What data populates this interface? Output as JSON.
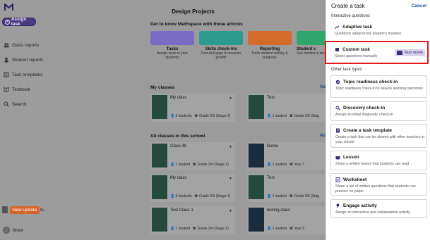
{
  "sidebar": {
    "assign_label": "Assign task",
    "items": [
      {
        "label": "Class reports",
        "icon": "people-icon"
      },
      {
        "label": "Student reports",
        "icon": "person-icon"
      },
      {
        "label": "Task templates",
        "icon": "templates-icon"
      },
      {
        "label": "Textbook",
        "icon": "book-icon"
      },
      {
        "label": "Search",
        "icon": "search-icon"
      }
    ],
    "new_update_label": "New update",
    "hidden_label_fragment": "ts",
    "more_label": "More"
  },
  "main": {
    "title": "Design Projects",
    "get_to_know": "Get to know Mathspace with these articles",
    "features": [
      {
        "title": "Tasks",
        "sub": "Assign work to your students",
        "color": "#7a6bc4"
      },
      {
        "title": "Skills check-ins",
        "sub": "Find skill gaps & measure growth",
        "color": "#2c9a8c"
      },
      {
        "title": "Reporting",
        "sub": "Track student activity & progress",
        "color": "#d56a2d"
      },
      {
        "title": "Student v",
        "sub": "See familiar w students s",
        "color": "#2fa66e"
      }
    ],
    "my_classes": "My classes",
    "all_classes": "All classes in this school",
    "add_label": "Ad",
    "classes": [
      {
        "name": "My class",
        "students": "0 students",
        "grade": "Grade 5/6 (Stage 3)"
      },
      {
        "name": "Test",
        "students": "1 student",
        "grade": "Grade 5/6 (Stag"
      },
      {
        "name": "Class 4b",
        "students": "1 student",
        "grade": "Grade 3/4 (Stage 2)"
      },
      {
        "name": "Demo",
        "students": "1 student",
        "grade": "Year 7"
      },
      {
        "name": "My class",
        "students": "0 students",
        "grade": "Grade 5/6 (Stage 3)"
      },
      {
        "name": "Test",
        "students": "1 student",
        "grade": "Grade 5/6 (Stag"
      },
      {
        "name": "Test Class 1",
        "students": "1 student",
        "grade": "Grade 3/4 (Stage 2)"
      },
      {
        "name": "testing class",
        "students": "1 student",
        "grade": "Year 9"
      }
    ]
  },
  "panel": {
    "title": "Create a task",
    "cancel": "Cancel",
    "interactive_header": "Interactive questions",
    "other_header": "Other task types",
    "interactive": [
      {
        "title": "Adaptive task",
        "desc": "Questions adapt to the student's mastery",
        "icon": "adaptive-icon"
      },
      {
        "title": "Custom task",
        "desc": "Select questions manually",
        "icon": "custom-icon",
        "badge": "Test mode"
      }
    ],
    "other": [
      {
        "title": "Topic readiness check-in",
        "desc": "Topic readiness check-in to assess learning outcomes",
        "icon": "readiness-icon"
      },
      {
        "title": "Discovery check-in",
        "desc": "Assign an initial diagnostic check-in",
        "icon": "discovery-icon"
      },
      {
        "title": "Create a task template",
        "desc": "Create a task that can be shared with other teachers in your school",
        "icon": "template-icon"
      },
      {
        "title": "Lesson",
        "desc": "Share a written lesson that students can read",
        "icon": "lesson-icon"
      },
      {
        "title": "Worksheet",
        "desc": "Share a set of written questions that students can practice on paper",
        "icon": "worksheet-icon"
      },
      {
        "title": "Engage activity",
        "desc": "Assign an interactive and collaborative activity",
        "icon": "engage-icon"
      }
    ],
    "highlight_color": "#e01b1b"
  }
}
